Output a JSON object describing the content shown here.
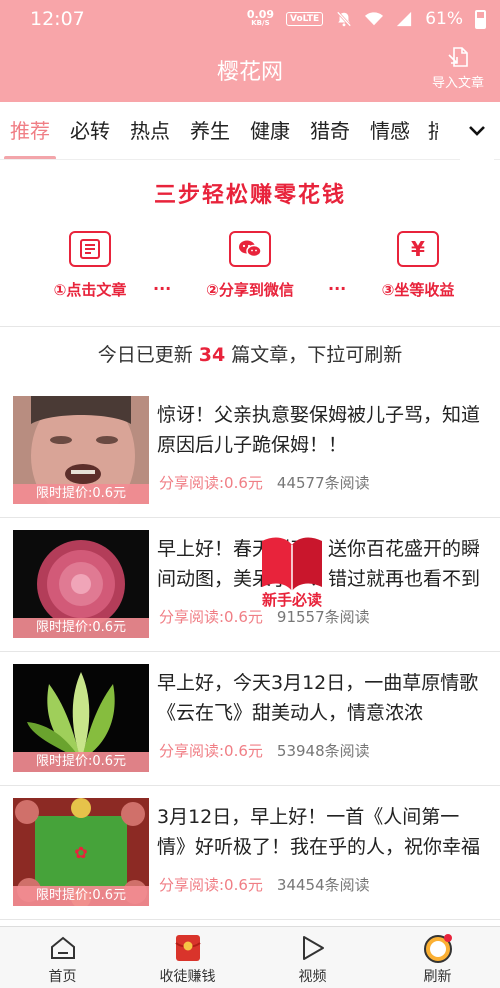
{
  "status": {
    "time": "12:07",
    "speed": "0.09",
    "speed_unit": "KB/S",
    "volte": "VoLTE",
    "battery": "61%"
  },
  "header": {
    "title": "樱花网",
    "import_label": "导入文章"
  },
  "tabs": [
    "推荐",
    "必转",
    "热点",
    "养生",
    "健康",
    "猎奇",
    "情感",
    "搞"
  ],
  "promo": {
    "title": "三步轻松赚零花钱",
    "steps": [
      "①点击文章",
      "②分享到微信",
      "③坐等收益"
    ],
    "dots": "···"
  },
  "update": {
    "prefix": "今日已更新 ",
    "count": "34",
    "suffix": " 篇文章，下拉可刷新"
  },
  "articles": [
    {
      "title": "惊讶！父亲执意娶保姆被儿子骂，知道原因后儿子跪保姆！！",
      "price": "限时提价:0.6元",
      "share": "分享阅读:0.6元",
      "reads": "44577条阅读"
    },
    {
      "title": "早上好！春天到了，送你百花盛开的瞬间动图，美呆了！！错过就再也看不到了",
      "price": "限时提价:0.6元",
      "share": "分享阅读:0.6元",
      "reads": "91557条阅读"
    },
    {
      "title": "早上好，今天3月12日，一曲草原情歌《云在飞》甜美动人，情意浓浓",
      "price": "限时提价:0.6元",
      "share": "分享阅读:0.6元",
      "reads": "53948条阅读"
    },
    {
      "title": "3月12日，早上好！一首《人间第一情》好听极了！我在乎的人，祝你幸福",
      "price": "限时提价:0.6元",
      "share": "分享阅读:0.6元",
      "reads": "34454条阅读"
    }
  ],
  "badge": {
    "label": "新手必读"
  },
  "nav": [
    {
      "label": "首页",
      "icon": "home-icon"
    },
    {
      "label": "收徒赚钱",
      "icon": "red-envelope-icon"
    },
    {
      "label": "视频",
      "icon": "play-icon"
    },
    {
      "label": "刷新",
      "icon": "refresh-icon"
    }
  ],
  "colors": {
    "brand": "#f8a5a9",
    "accent": "#e8233b",
    "share": "#f07e85"
  }
}
